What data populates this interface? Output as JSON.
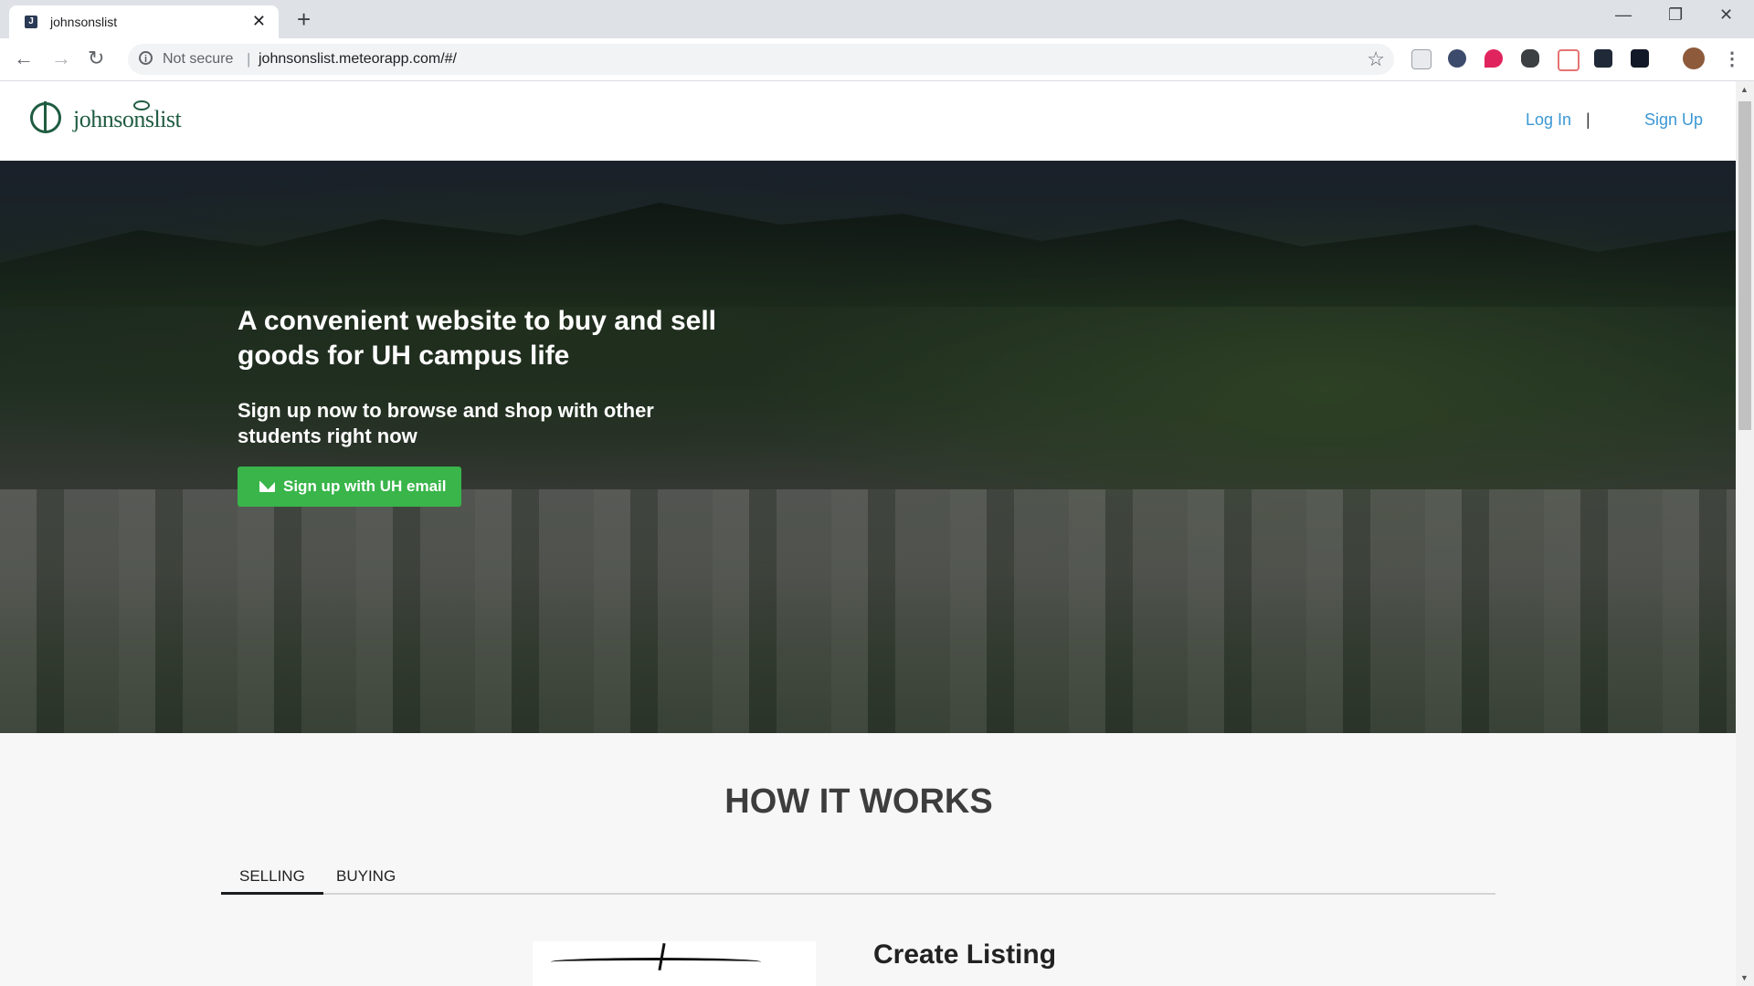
{
  "browser": {
    "tab_title": "johnsonslist",
    "favicon_letter": "J",
    "security_text": "Not secure",
    "url": "johnsonslist.meteorapp.com/#/"
  },
  "header": {
    "logo_text": "johnsonslist",
    "login_label": "Log In",
    "separator": "|",
    "signup_label": "Sign Up",
    "link_color": "#3b97d3",
    "brand_color": "#1f5c41"
  },
  "hero": {
    "title": "A convenient website to buy and sell goods for UH campus life",
    "subtitle": "Sign up now to browse and shop with other students right now",
    "cta_label": "Sign up with UH email",
    "cta_color": "#39b54a"
  },
  "how_it_works": {
    "title": "HOW IT WORKS",
    "tabs": [
      {
        "label": "SELLING",
        "active": true
      },
      {
        "label": "BUYING",
        "active": false
      }
    ],
    "step_title": "Create Listing"
  }
}
